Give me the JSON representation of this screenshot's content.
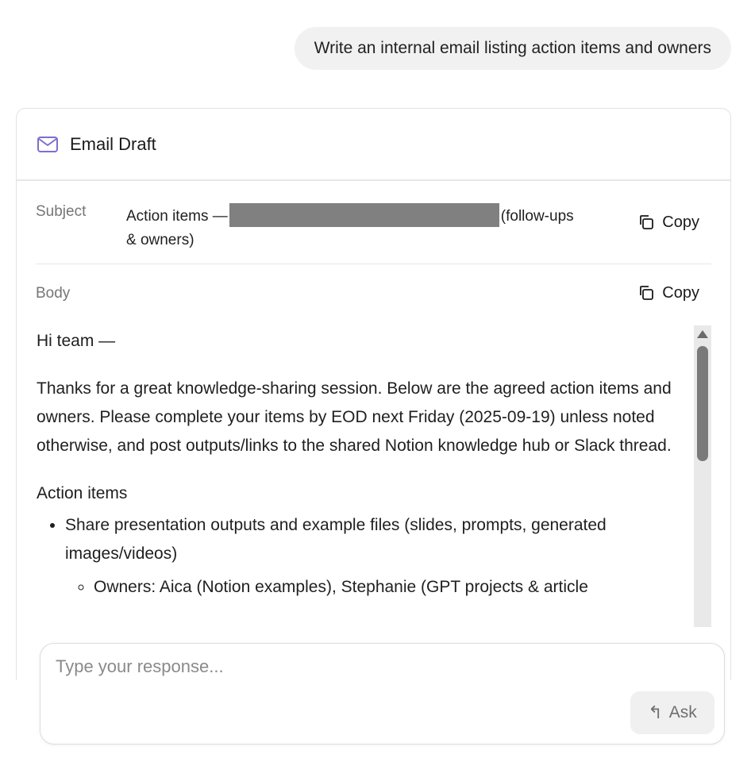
{
  "user_message": "Write an internal email listing action items and owners",
  "card": {
    "title": "Email Draft",
    "icon": "mail-icon",
    "accent_color": "#7b6fd0"
  },
  "subject": {
    "label": "Subject",
    "text_before": "Action items —",
    "text_after": "(follow-ups & owners)",
    "copy_label": "Copy"
  },
  "body": {
    "label": "Body",
    "copy_label": "Copy",
    "greeting": "Hi team —",
    "paragraph": "Thanks for a great knowledge-sharing session. Below are the agreed action items and owners. Please complete your items by EOD next Friday (2025-09-19) unless noted otherwise, and post outputs/links to the shared Notion knowledge hub or Slack thread.",
    "section_title": "Action items",
    "items": [
      {
        "text": "Share presentation outputs and example files (slides, prompts, generated images/videos)",
        "sub": [
          "Owners: Aica (Notion examples), Stephanie (GPT projects & article"
        ]
      }
    ]
  },
  "composer": {
    "placeholder": "Type your response...",
    "ask_label": "Ask"
  }
}
